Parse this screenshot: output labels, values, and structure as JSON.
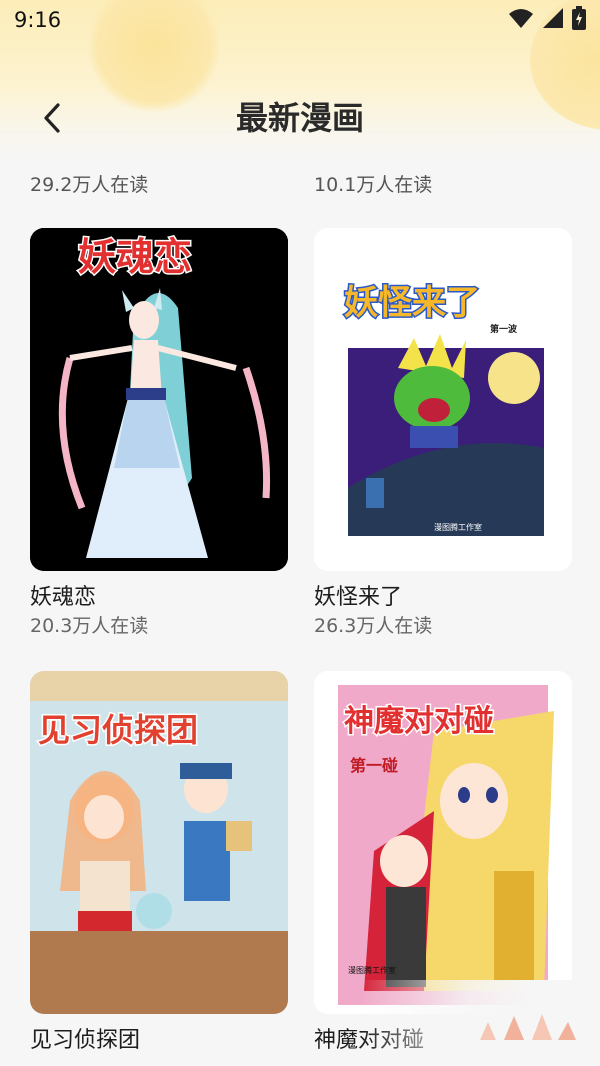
{
  "status_bar": {
    "time": "9:16"
  },
  "header": {
    "title": "最新漫画"
  },
  "partial_row": {
    "left_count": "29.2万人在读",
    "right_count": "10.1万人在读"
  },
  "comics": [
    {
      "title": "妖魂恋",
      "readers": "20.3万人在读",
      "cover_text": "妖魂恋"
    },
    {
      "title": "妖怪来了",
      "readers": "26.3万人在读",
      "cover_text": "妖怪来了",
      "cover_subtext": "第一波",
      "publisher": "漫图腾工作室"
    },
    {
      "title": "见习侦探团",
      "readers": "",
      "cover_text": "见习侦探团"
    },
    {
      "title": "神魔对对碰",
      "readers": "",
      "cover_text": "神魔对对碰",
      "cover_subtext": "第一碰",
      "publisher": "漫图腾工作室"
    }
  ],
  "colors": {
    "header_gradient_top": "#fcedb8",
    "page_bg": "#f6f6f6",
    "title_color": "#2a2a2a"
  }
}
